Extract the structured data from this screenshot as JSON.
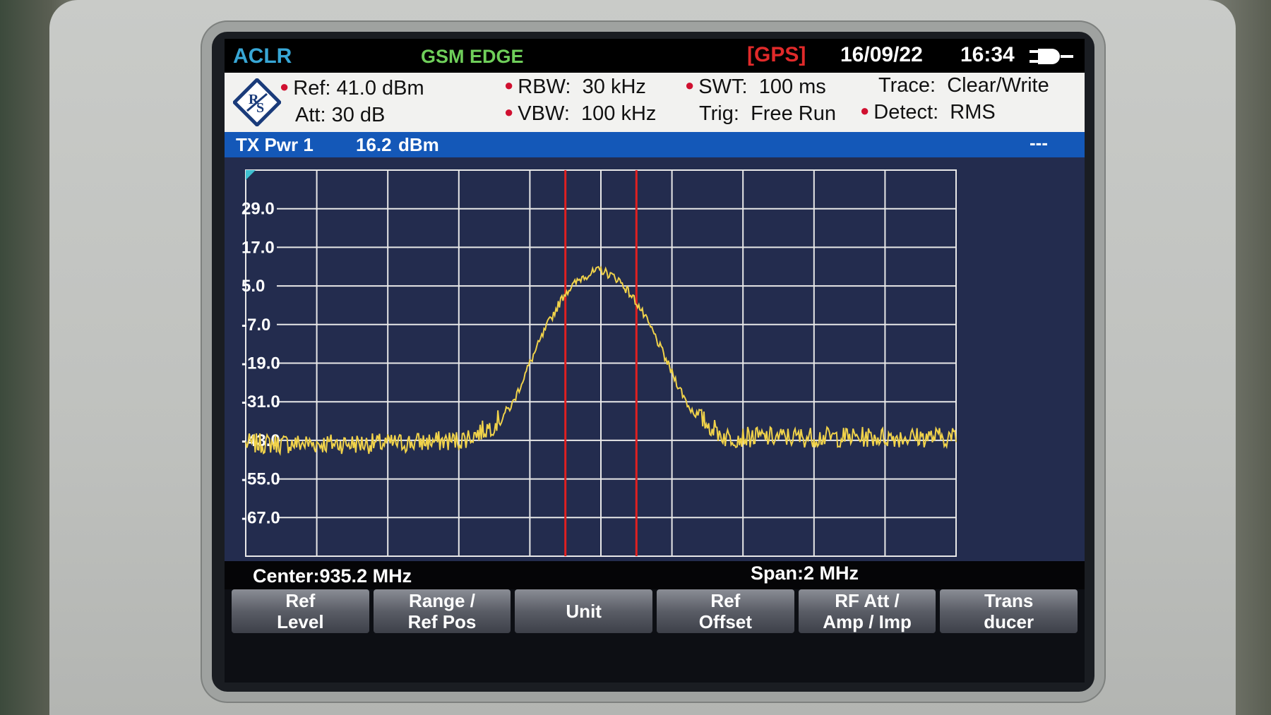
{
  "status": {
    "mode": "ACLR",
    "standard": "GSM EDGE",
    "gps": "[GPS]",
    "date": "16/09/22",
    "time": "16:34"
  },
  "settings": {
    "ref_label": "Ref:",
    "ref_value": "41.0 dBm",
    "att_label": "Att:",
    "att_value": "30 dB",
    "rbw_label": "RBW:",
    "rbw_value": "30 kHz",
    "vbw_label": "VBW:",
    "vbw_value": "100 kHz",
    "swt_label": "SWT:",
    "swt_value": "100 ms",
    "trig_label": "Trig:",
    "trig_value": "Free Run",
    "trace_label": "Trace:",
    "trace_value": "Clear/Write",
    "detect_label": "Detect:",
    "detect_value": "RMS"
  },
  "tx": {
    "label": "TX Pwr 1",
    "value": "16.2",
    "unit": "dBm",
    "extra": "---"
  },
  "footer": {
    "center": "Center:935.2 MHz",
    "span": "Span:2 MHz"
  },
  "softkeys": [
    {
      "line1": "Ref",
      "line2": "Level"
    },
    {
      "line1": "Range /",
      "line2": "Ref Pos"
    },
    {
      "line1": "Unit",
      "line2": ""
    },
    {
      "line1": "Ref",
      "line2": "Offset"
    },
    {
      "line1": "RF Att /",
      "line2": "Amp / Imp"
    },
    {
      "line1": "Trans",
      "line2": "ducer"
    }
  ],
  "colors": {
    "trace": "#f0d24a",
    "channel_lines": "#e02020",
    "grid": "#e8e8e8",
    "plot_bg": "#232c4e",
    "tx_bar": "#1458b8"
  },
  "chart_data": {
    "type": "line",
    "title": "",
    "xlabel": "",
    "ylabel": "",
    "x_range": [
      934.2,
      936.2
    ],
    "x_unit": "MHz",
    "ylim": [
      -79.0,
      41.0
    ],
    "y_ticks": [
      29.0,
      17.0,
      5.0,
      -7.0,
      -19.0,
      -31.0,
      -43.0,
      -55.0,
      -67.0
    ],
    "y_tick_labels": [
      "29.0",
      "17.0",
      "5.0",
      "-7.0",
      "-19.0",
      "-31.0",
      "-43.0",
      "-55.0",
      "-67.0"
    ],
    "grid": true,
    "channel_markers": [
      935.1,
      935.3
    ],
    "series": [
      {
        "x": [
          934.2,
          934.4,
          934.6,
          934.8,
          934.85,
          934.9,
          934.95,
          935.0,
          935.05,
          935.1,
          935.15,
          935.2,
          935.25,
          935.3,
          935.35,
          935.4,
          935.45,
          935.5,
          935.55,
          935.6,
          935.8,
          936.0,
          936.2
        ],
        "y": [
          -44,
          -44,
          -44,
          -43,
          -41,
          -38,
          -32,
          -19,
          -7,
          3,
          8,
          10,
          7,
          0,
          -10,
          -22,
          -33,
          -38,
          -42,
          -42,
          -42,
          -42,
          -42
        ]
      }
    ]
  }
}
